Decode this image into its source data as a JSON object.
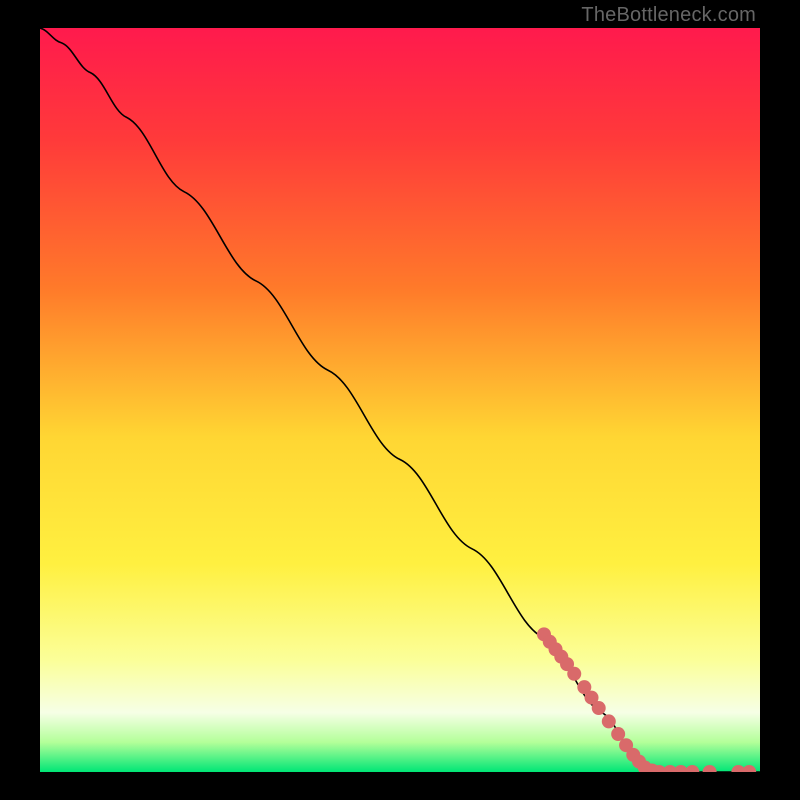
{
  "attribution": "TheBottleneck.com",
  "chart_data": {
    "type": "line",
    "title": "",
    "xlabel": "",
    "ylabel": "",
    "xlim": [
      0,
      100
    ],
    "ylim": [
      0,
      100
    ],
    "grid": false,
    "legend": false,
    "background_gradient": {
      "stops": [
        {
          "pos": 0.0,
          "color": "#ff1a4d"
        },
        {
          "pos": 0.15,
          "color": "#ff3a3a"
        },
        {
          "pos": 0.35,
          "color": "#ff7a2a"
        },
        {
          "pos": 0.55,
          "color": "#ffd633"
        },
        {
          "pos": 0.72,
          "color": "#fff040"
        },
        {
          "pos": 0.85,
          "color": "#fbff99"
        },
        {
          "pos": 0.92,
          "color": "#f6ffe6"
        },
        {
          "pos": 0.96,
          "color": "#b3ff99"
        },
        {
          "pos": 1.0,
          "color": "#00e676"
        }
      ]
    },
    "series": [
      {
        "name": "curve",
        "color": "#000000",
        "width": 1.6,
        "points": [
          {
            "x": 0,
            "y": 100
          },
          {
            "x": 3,
            "y": 98
          },
          {
            "x": 7,
            "y": 94
          },
          {
            "x": 12,
            "y": 88
          },
          {
            "x": 20,
            "y": 78
          },
          {
            "x": 30,
            "y": 66
          },
          {
            "x": 40,
            "y": 54
          },
          {
            "x": 50,
            "y": 42
          },
          {
            "x": 60,
            "y": 30
          },
          {
            "x": 70,
            "y": 18
          },
          {
            "x": 78,
            "y": 8
          },
          {
            "x": 83,
            "y": 2
          },
          {
            "x": 86,
            "y": 0
          },
          {
            "x": 100,
            "y": 0
          }
        ]
      }
    ],
    "markers": {
      "name": "dots",
      "color": "#d96a6a",
      "radius": 7,
      "points": [
        {
          "x": 70.0,
          "y": 18.5
        },
        {
          "x": 70.8,
          "y": 17.5
        },
        {
          "x": 71.6,
          "y": 16.5
        },
        {
          "x": 72.4,
          "y": 15.5
        },
        {
          "x": 73.2,
          "y": 14.5
        },
        {
          "x": 74.2,
          "y": 13.2
        },
        {
          "x": 75.6,
          "y": 11.4
        },
        {
          "x": 76.6,
          "y": 10.0
        },
        {
          "x": 77.6,
          "y": 8.6
        },
        {
          "x": 79.0,
          "y": 6.8
        },
        {
          "x": 80.3,
          "y": 5.1
        },
        {
          "x": 81.4,
          "y": 3.6
        },
        {
          "x": 82.4,
          "y": 2.3
        },
        {
          "x": 83.2,
          "y": 1.4
        },
        {
          "x": 84.0,
          "y": 0.6
        },
        {
          "x": 85.0,
          "y": 0.2
        },
        {
          "x": 86.0,
          "y": 0.0
        },
        {
          "x": 87.5,
          "y": 0.0
        },
        {
          "x": 89.0,
          "y": 0.0
        },
        {
          "x": 90.6,
          "y": 0.0
        },
        {
          "x": 93.0,
          "y": 0.0
        },
        {
          "x": 97.0,
          "y": 0.0
        },
        {
          "x": 98.5,
          "y": 0.0
        }
      ]
    }
  }
}
